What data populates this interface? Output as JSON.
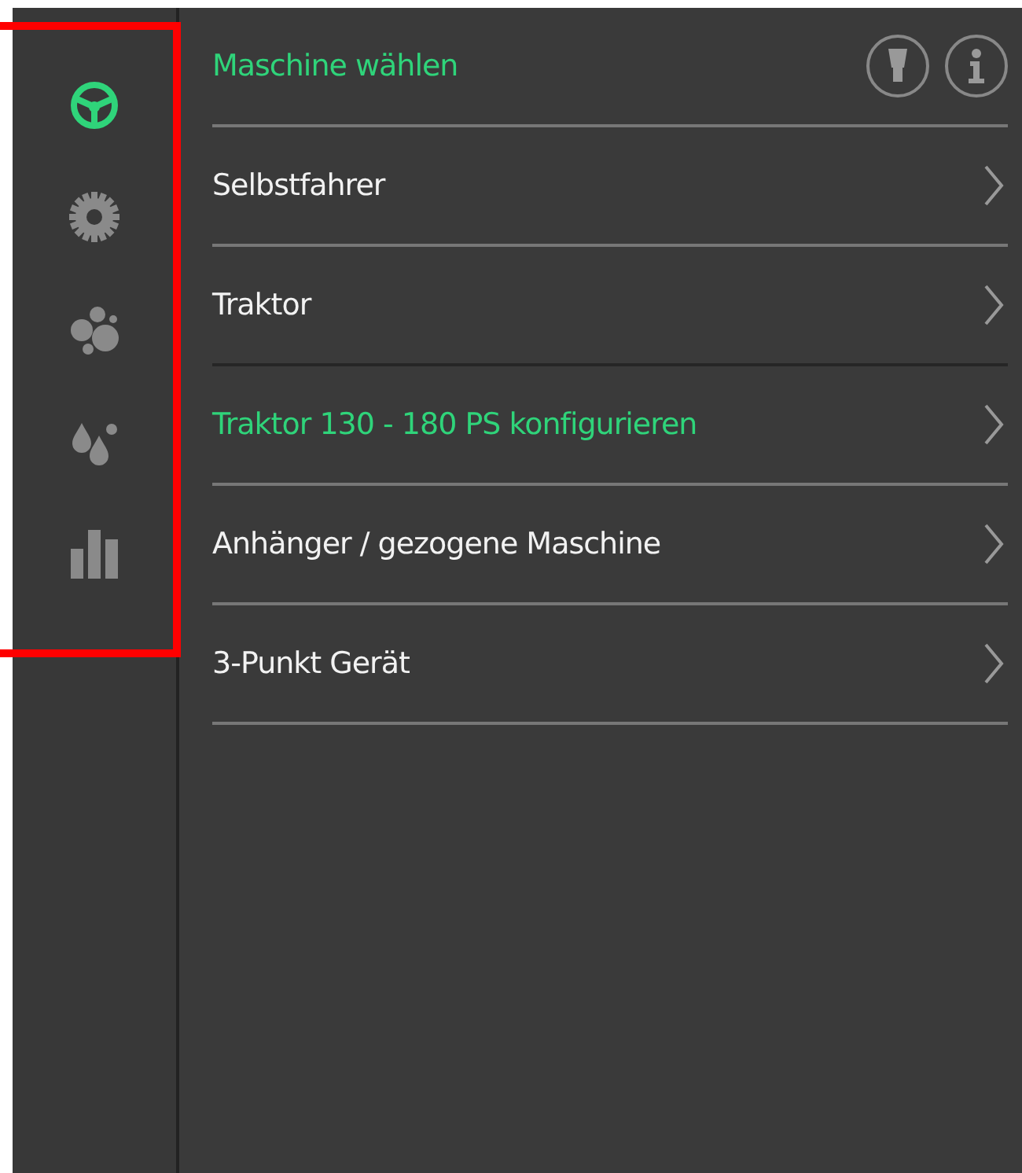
{
  "sidebar": {
    "items": [
      {
        "selected": true
      },
      {
        "selected": false
      },
      {
        "selected": false
      },
      {
        "selected": false
      },
      {
        "selected": false
      }
    ]
  },
  "panel": {
    "title": "Maschine wählen",
    "items": [
      {
        "label": "Selbstfahrer",
        "selected": false
      },
      {
        "label": "Traktor",
        "selected": false
      },
      {
        "label": "Traktor 130 - 180 PS konfigurieren",
        "selected": true
      },
      {
        "label": "Anhänger / gezogene Maschine",
        "selected": false
      },
      {
        "label": "3-Punkt Gerät",
        "selected": false
      }
    ]
  }
}
